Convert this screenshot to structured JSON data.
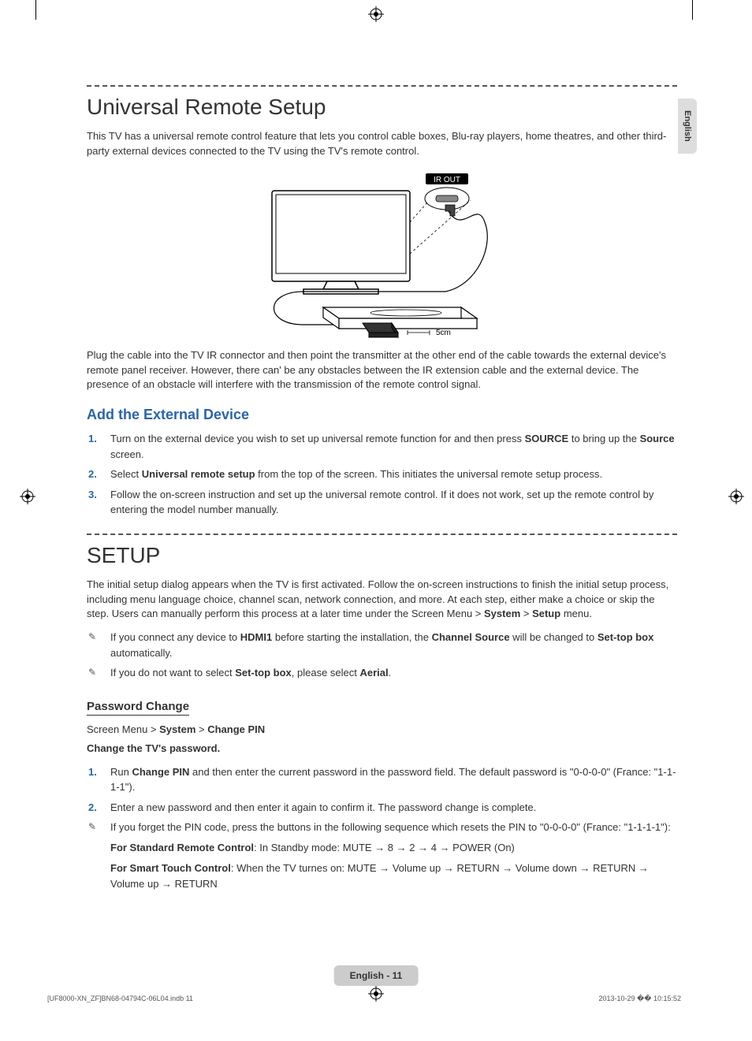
{
  "side_tab": "English",
  "section1": {
    "title": "Universal Remote Setup",
    "intro": "This TV has a universal remote control feature that lets you control cable boxes, Blu-ray players, home theatres, and other third-party external devices connected to the TV using the TV's remote control.",
    "diagram_labels": {
      "ir_out": "IR OUT",
      "distance": "5cm"
    },
    "after_diagram": "Plug the cable into the TV IR connector and then point the transmitter at the other end of the cable towards the external device's remote panel receiver. However, there can' be any obstacles between the IR extension cable and the external device. The presence of an obstacle will interfere with the transmission of the remote control signal.",
    "subsection_title": "Add the External Device",
    "steps": [
      {
        "pre": "Turn on the external device you wish to set up universal remote function for and then press ",
        "b1": "SOURCE",
        "mid": " to bring up the ",
        "b2": "Source",
        "post": " screen."
      },
      {
        "pre": "Select ",
        "b1": "Universal remote setup",
        "post": " from the top of the screen. This initiates the universal remote setup process."
      },
      {
        "pre": "Follow the on-screen instruction and set up the universal remote control. If it does not work, set up the remote control by entering the model number manually."
      }
    ]
  },
  "section2": {
    "title": "SETUP",
    "intro_pre": "The initial setup dialog appears when the TV is first activated. Follow the on-screen instructions to finish the initial setup process, including menu language choice, channel scan, network connection, and more. At each step, either make a choice or skip the step. Users can manually perform this process at a later time under the Screen Menu > ",
    "intro_b1": "System",
    "intro_mid": " > ",
    "intro_b2": "Setup",
    "intro_post": " menu.",
    "notes": [
      {
        "pre": "If you connect any device to ",
        "b1": "HDMI1",
        "mid": " before starting the installation, the ",
        "b2": "Channel Source",
        "mid2": " will be changed to ",
        "b3": "Set-top box",
        "post": " automatically."
      },
      {
        "pre": "If you do not want to select ",
        "b1": "Set-top box",
        "mid": ", please select ",
        "b2": "Aerial",
        "post": "."
      }
    ],
    "pw_title": "Password Change",
    "pw_breadcrumb_pre": "Screen Menu > ",
    "pw_breadcrumb_b1": "System",
    "pw_breadcrumb_mid": " > ",
    "pw_breadcrumb_b2": "Change PIN",
    "pw_change_label": "Change the TV's password.",
    "pw_steps": [
      {
        "pre": "Run ",
        "b1": "Change PIN",
        "post": " and then enter the current password in the password field. The default password is \"0-0-0-0\" (France: \"1-1-1-1\")."
      },
      {
        "pre": "Enter a new password and then enter it again to confirm it. The password change is complete."
      }
    ],
    "pw_note": "If you forget the PIN code, press the buttons in the following sequence which resets the PIN to  \"0-0-0-0\" (France: \"1-1-1-1\"):",
    "remote1_label": "For Standard Remote Control",
    "remote1_seq": ": In Standby mode: MUTE → 8 → 2 → 4 → POWER (On)",
    "remote2_label": "For Smart Touch Control",
    "remote2_seq": ": When the TV turnes on: MUTE → Volume up → RETURN → Volume down → RETURN → Volume up → RETURN"
  },
  "footer": {
    "page_label": "English - 11",
    "left_meta": "[UF8000-XN_ZF]BN68-04794C-06L04.indb   11",
    "right_meta": "2013-10-29   �� 10:15:52"
  }
}
